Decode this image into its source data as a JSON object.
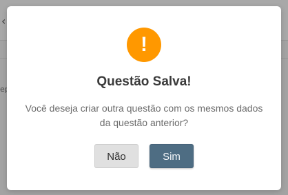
{
  "dialog": {
    "icon": "exclamation-icon",
    "icon_glyph": "!",
    "title": "Questão Salva!",
    "message": "Você deseja criar outra questão com os mesmos dados da questão anterior?",
    "no_label": "Não",
    "yes_label": "Sim"
  },
  "colors": {
    "accent": "#ff9800",
    "primary_button": "#4e6d83",
    "secondary_button": "#e0e0e0"
  }
}
